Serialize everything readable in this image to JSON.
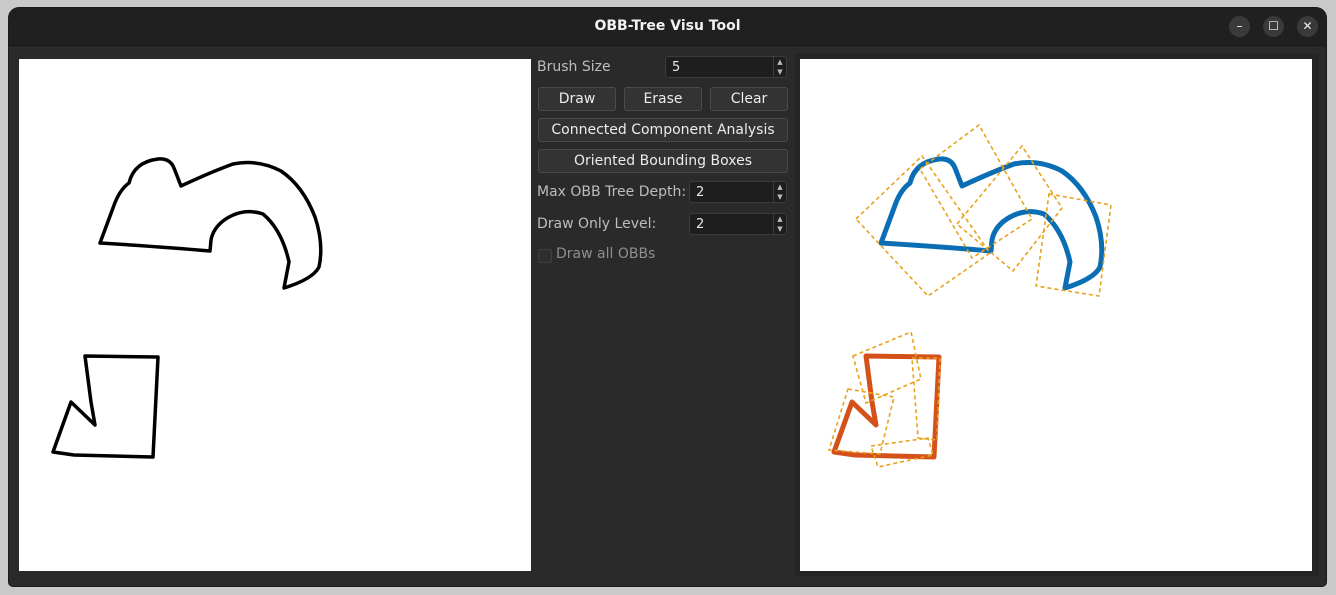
{
  "window": {
    "title": "OBB-Tree Visu Tool",
    "minimize_glyph": "–",
    "maximize_glyph": "☐",
    "close_glyph": "✕"
  },
  "controls": {
    "brush_size_label": "Brush Size",
    "brush_size_value": "5",
    "draw_label": "Draw",
    "erase_label": "Erase",
    "clear_label": "Clear",
    "cca_label": "Connected Component Analysis",
    "obb_label": "Oriented Bounding Boxes",
    "max_depth_label": "Max OBB Tree Depth:",
    "max_depth_value": "2",
    "draw_level_label": "Draw Only Level:",
    "draw_level_value": "2",
    "draw_all_label": "Draw all OBBs",
    "draw_all_checked": false
  },
  "colors": {
    "component_1": "#0a6eb4",
    "component_2": "#d4521a",
    "obb": "#e8a21c",
    "stroke": "#000000"
  }
}
